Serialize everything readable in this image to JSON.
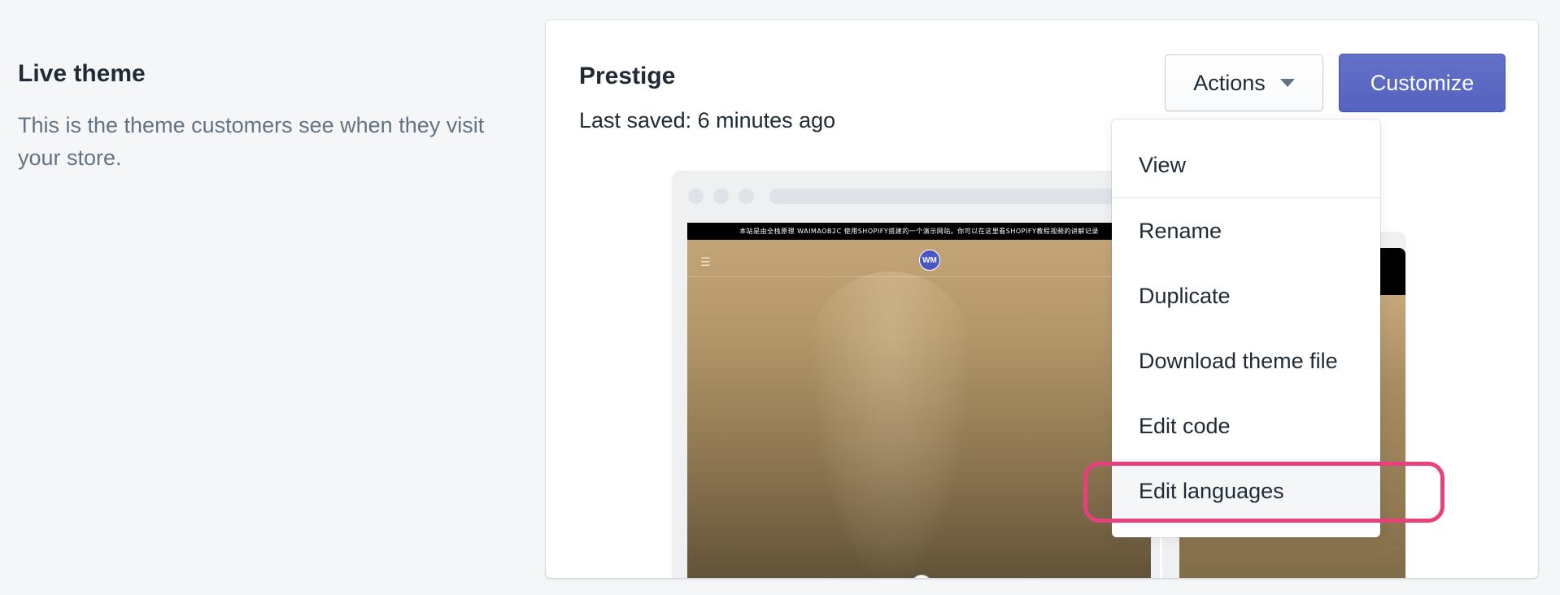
{
  "section": {
    "title": "Live theme",
    "description": "This is the theme customers see when they visit your store."
  },
  "theme": {
    "name": "Prestige",
    "last_saved": "Last saved: 6 minutes ago",
    "actions_label": "Actions",
    "customize_label": "Customize"
  },
  "preview": {
    "announcement": "本站是由全栈原理 WAIMAOB2C 使用SHOPIFY搭建的一个演示网站。你可以在这里看SHOPIFY教程视频的讲解记录",
    "logo_text": "WM"
  },
  "dropdown": {
    "items": [
      {
        "label": "View"
      },
      {
        "label": "Rename"
      },
      {
        "label": "Duplicate"
      },
      {
        "label": "Download theme file"
      },
      {
        "label": "Edit code"
      },
      {
        "label": "Edit languages"
      }
    ]
  },
  "colors": {
    "accent": "#5c6ac4",
    "highlight": "#e8407d"
  }
}
